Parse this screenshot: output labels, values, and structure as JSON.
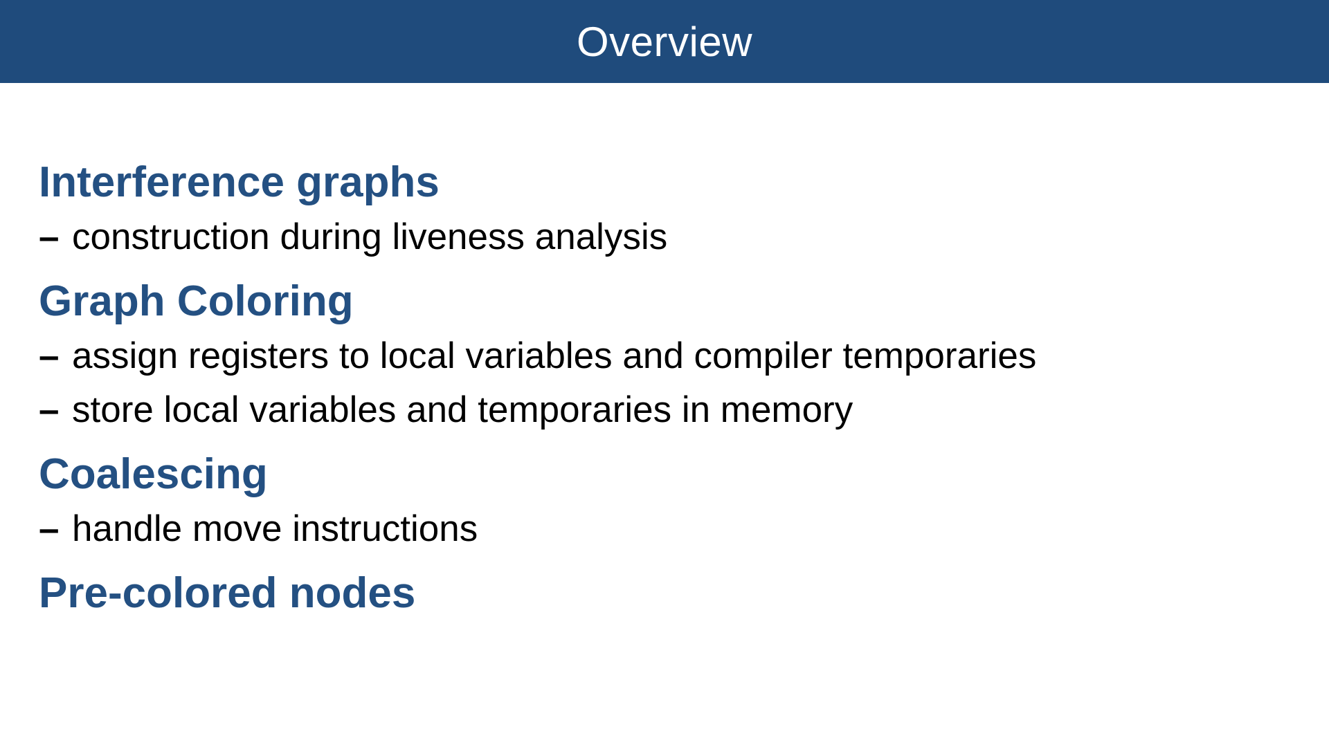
{
  "colors": {
    "title_bar_background": "#1f4b7c",
    "title_text": "#ffffff",
    "heading_text": "#245082",
    "body_text": "#000000"
  },
  "slide": {
    "title": "Overview",
    "sections": [
      {
        "heading": "Interference graphs",
        "bullets": [
          "construction during liveness analysis"
        ]
      },
      {
        "heading": "Graph Coloring",
        "bullets": [
          "assign registers to local variables and compiler temporaries",
          "store local variables and temporaries in memory"
        ]
      },
      {
        "heading": "Coalescing",
        "bullets": [
          "handle move instructions"
        ]
      },
      {
        "heading": "Pre-colored nodes",
        "bullets": []
      }
    ],
    "bullet_marker": "–"
  }
}
